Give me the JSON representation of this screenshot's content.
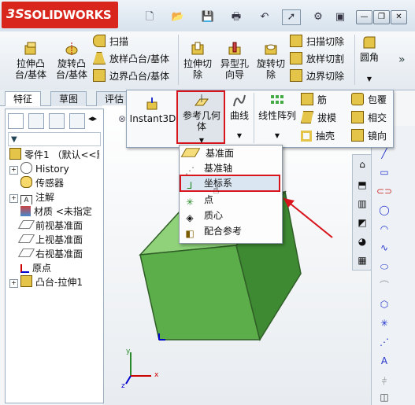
{
  "app": {
    "name": "SOLIDWORKS",
    "logo_mark": "3S"
  },
  "window_controls": {
    "minimize": "—",
    "restore": "❐",
    "close": "✕"
  },
  "ribbon": {
    "extrude_boss": "拉伸凸\n台/基体",
    "revolve_boss": "旋转凸\n台/基体",
    "sweep": "扫描",
    "loft_boss": "放样凸台/基体",
    "boundary_boss": "边界凸台/基体",
    "extrude_cut": "拉伸切\n除",
    "hole_wizard": "异型孔\n向导",
    "revolve_cut": "旋转切\n除",
    "sweep_cut": "扫描切除",
    "loft_cut": "放样切割",
    "boundary_cut": "边界切除",
    "fillet": "圆角",
    "more": "»"
  },
  "tabs": [
    "特征",
    "草图",
    "评估"
  ],
  "flyout": {
    "instant3d": "Instant3D",
    "ref_geometry": "参考几何\n体",
    "curves": "曲线",
    "linear_pattern": "线性阵列",
    "rib": "筋",
    "draft": "拔模",
    "shell": "抽壳",
    "wrap": "包覆",
    "intersect": "相交",
    "mirror": "镜向"
  },
  "dropdown": {
    "items": [
      "基准面",
      "基准轴",
      "坐标系",
      "点",
      "质心",
      "配合参考"
    ],
    "highlighted_index": 2
  },
  "tree": {
    "root": "零件1 （默认<<默",
    "items": [
      "History",
      "传感器",
      "注解",
      "材质 <未指定",
      "前视基准面",
      "上视基准面",
      "右视基准面",
      "原点",
      "凸台-拉伸1"
    ]
  },
  "axes": {
    "x": "x",
    "y": "y",
    "z": "z"
  },
  "colors": {
    "cube_front": "#5cae4a",
    "cube_top": "#8fd27a",
    "cube_side": "#3e8a33",
    "highlight": "#d8141c",
    "logo_bg": "#d9261c"
  }
}
